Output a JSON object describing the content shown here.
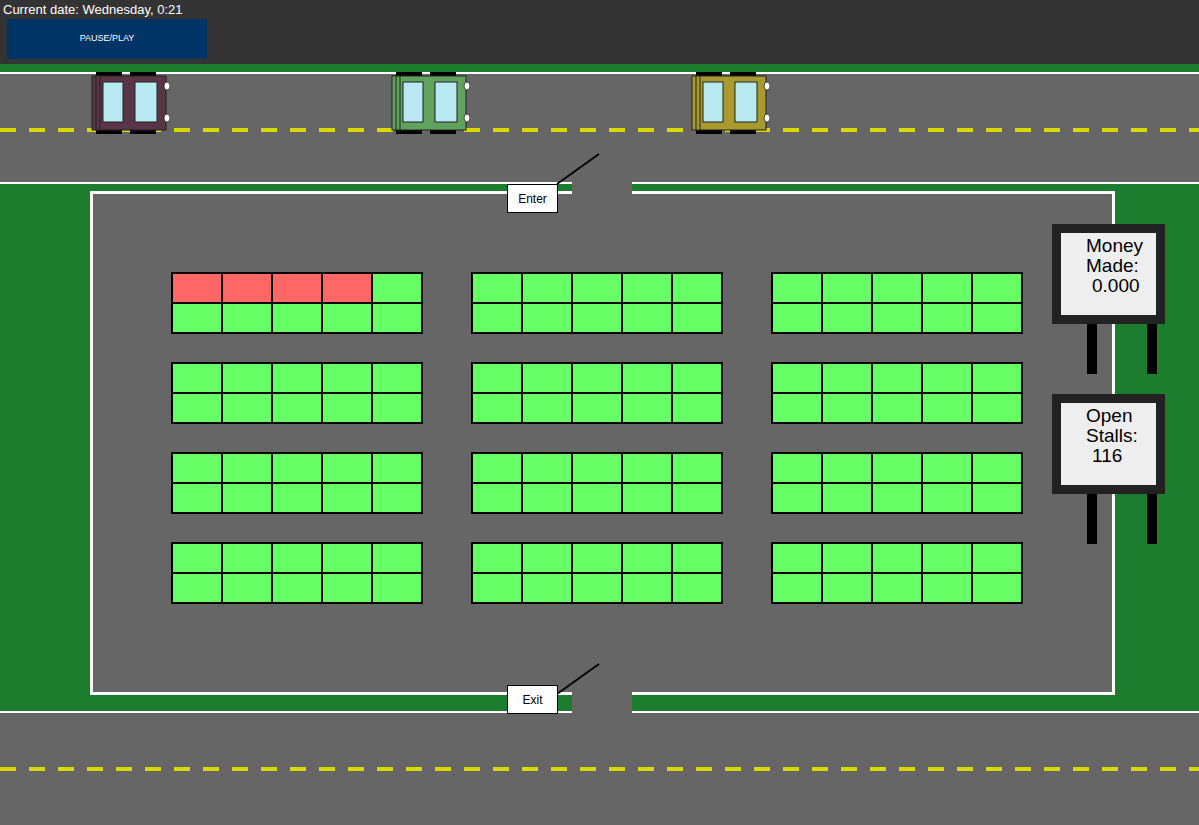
{
  "status": {
    "date": "Current date: Wednesday, 0:21"
  },
  "buttons": [
    "PAUSE/PLAY"
  ],
  "cars": [
    {
      "color": "#5a3447"
    },
    {
      "color": "#5fa35f"
    },
    {
      "color": "#a99a2e"
    }
  ],
  "gates": [
    {
      "label": "Enter"
    },
    {
      "label": "Exit"
    }
  ],
  "signs": [
    {
      "title": [
        "Money",
        "Made:"
      ],
      "value": "0.000"
    },
    {
      "title": [
        "Open",
        "Stalls:"
      ],
      "value": "116"
    }
  ],
  "lots": [
    {
      "stalls": [
        {
          "occupied": true
        },
        {
          "occupied": true
        },
        {
          "occupied": true
        },
        {
          "occupied": true
        },
        {
          "occupied": false
        },
        {
          "occupied": false
        },
        {
          "occupied": false
        },
        {
          "occupied": false
        },
        {
          "occupied": false
        },
        {
          "occupied": false
        }
      ]
    },
    {
      "stalls": [
        {
          "occupied": false
        },
        {
          "occupied": false
        },
        {
          "occupied": false
        },
        {
          "occupied": false
        },
        {
          "occupied": false
        },
        {
          "occupied": false
        },
        {
          "occupied": false
        },
        {
          "occupied": false
        },
        {
          "occupied": false
        },
        {
          "occupied": false
        }
      ]
    },
    {
      "stalls": [
        {
          "occupied": false
        },
        {
          "occupied": false
        },
        {
          "occupied": false
        },
        {
          "occupied": false
        },
        {
          "occupied": false
        },
        {
          "occupied": false
        },
        {
          "occupied": false
        },
        {
          "occupied": false
        },
        {
          "occupied": false
        },
        {
          "occupied": false
        }
      ]
    },
    {
      "stalls": [
        {
          "occupied": false
        },
        {
          "occupied": false
        },
        {
          "occupied": false
        },
        {
          "occupied": false
        },
        {
          "occupied": false
        },
        {
          "occupied": false
        },
        {
          "occupied": false
        },
        {
          "occupied": false
        },
        {
          "occupied": false
        },
        {
          "occupied": false
        }
      ]
    },
    {
      "stalls": [
        {
          "occupied": false
        },
        {
          "occupied": false
        },
        {
          "occupied": false
        },
        {
          "occupied": false
        },
        {
          "occupied": false
        },
        {
          "occupied": false
        },
        {
          "occupied": false
        },
        {
          "occupied": false
        },
        {
          "occupied": false
        },
        {
          "occupied": false
        }
      ]
    },
    {
      "stalls": [
        {
          "occupied": false
        },
        {
          "occupied": false
        },
        {
          "occupied": false
        },
        {
          "occupied": false
        },
        {
          "occupied": false
        },
        {
          "occupied": false
        },
        {
          "occupied": false
        },
        {
          "occupied": false
        },
        {
          "occupied": false
        },
        {
          "occupied": false
        }
      ]
    },
    {
      "stalls": [
        {
          "occupied": false
        },
        {
          "occupied": false
        },
        {
          "occupied": false
        },
        {
          "occupied": false
        },
        {
          "occupied": false
        },
        {
          "occupied": false
        },
        {
          "occupied": false
        },
        {
          "occupied": false
        },
        {
          "occupied": false
        },
        {
          "occupied": false
        }
      ]
    },
    {
      "stalls": [
        {
          "occupied": false
        },
        {
          "occupied": false
        },
        {
          "occupied": false
        },
        {
          "occupied": false
        },
        {
          "occupied": false
        },
        {
          "occupied": false
        },
        {
          "occupied": false
        },
        {
          "occupied": false
        },
        {
          "occupied": false
        },
        {
          "occupied": false
        }
      ]
    },
    {
      "stalls": [
        {
          "occupied": false
        },
        {
          "occupied": false
        },
        {
          "occupied": false
        },
        {
          "occupied": false
        },
        {
          "occupied": false
        },
        {
          "occupied": false
        },
        {
          "occupied": false
        },
        {
          "occupied": false
        },
        {
          "occupied": false
        },
        {
          "occupied": false
        }
      ]
    },
    {
      "stalls": [
        {
          "occupied": false
        },
        {
          "occupied": false
        },
        {
          "occupied": false
        },
        {
          "occupied": false
        },
        {
          "occupied": false
        },
        {
          "occupied": false
        },
        {
          "occupied": false
        },
        {
          "occupied": false
        },
        {
          "occupied": false
        },
        {
          "occupied": false
        }
      ]
    },
    {
      "stalls": [
        {
          "occupied": false
        },
        {
          "occupied": false
        },
        {
          "occupied": false
        },
        {
          "occupied": false
        },
        {
          "occupied": false
        },
        {
          "occupied": false
        },
        {
          "occupied": false
        },
        {
          "occupied": false
        },
        {
          "occupied": false
        },
        {
          "occupied": false
        }
      ]
    },
    {
      "stalls": [
        {
          "occupied": false
        },
        {
          "occupied": false
        },
        {
          "occupied": false
        },
        {
          "occupied": false
        },
        {
          "occupied": false
        },
        {
          "occupied": false
        },
        {
          "occupied": false
        },
        {
          "occupied": false
        },
        {
          "occupied": false
        },
        {
          "occupied": false
        }
      ]
    }
  ]
}
